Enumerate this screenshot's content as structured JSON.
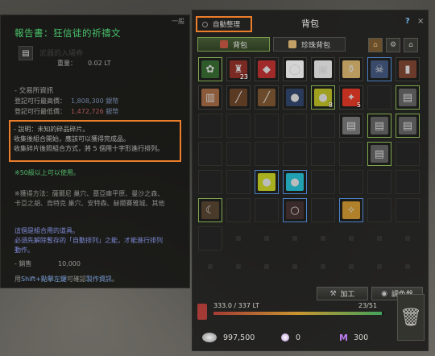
{
  "tooltip": {
    "rank": "一般",
    "title": "報告書：狂信徒的祈禱文",
    "watermark": "武器的入場券",
    "weight_label": "重量：",
    "weight_value": "0.02 LT",
    "market_section": "- 交易所資訊",
    "max_price_label": "登記可行最高價：",
    "max_price_value": "1,808,300",
    "max_price_unit": "銀幣",
    "min_price_label": "登記可行最低價：",
    "min_price_value": "1,472,726",
    "min_price_unit": "銀幣",
    "desc_lines": [
      "- 說明：未知的碎品碎片。",
      "收集後組合開始，應該可以獲得完成品。",
      "收集碎片後照組合方式，將 5 個用十字形進行排列。"
    ],
    "usable": "※50級以上可以使用。",
    "obtain_lines": [
      "※獲得方法：薩爾尼 巢穴、墓亞庫平原、曼沙之森、",
      "卡亞之胡、烏特克 巢穴、安特森、赫爾賽雅城、其他"
    ],
    "combine_lines": [
      "這個是組合用的道具。",
      "必須先解除暫存的「自動排列」之能，才能進行排列",
      "動作。"
    ],
    "sell_label": "- 銷售",
    "sell_value": "10,000",
    "footer_prefix": "用",
    "footer_key": "Shift+點擊左鍵",
    "footer_mid": "可確認",
    "footer_link": "製作資訊",
    "footer_suffix": "。"
  },
  "inventory": {
    "auto_sort": "自動整理",
    "title": "背包",
    "help": "?",
    "close": "×",
    "tabs": [
      "背包",
      "珍珠背包"
    ],
    "craft_button": "加工",
    "dye_button": "調色盤",
    "weight": "333.0 / 337 LT",
    "weight_fraction": 0.988,
    "slots": "23/51",
    "silver": "997,500",
    "pearls": "0",
    "miles": "300",
    "item_counts": {
      "slot_0_1": "23",
      "slot_1_4": "8",
      "slot_1_5": "5"
    }
  },
  "colors": {
    "highlight": "#ec7d2a",
    "title_green": "#49c26b",
    "tab_active": "#7a9a4b"
  }
}
